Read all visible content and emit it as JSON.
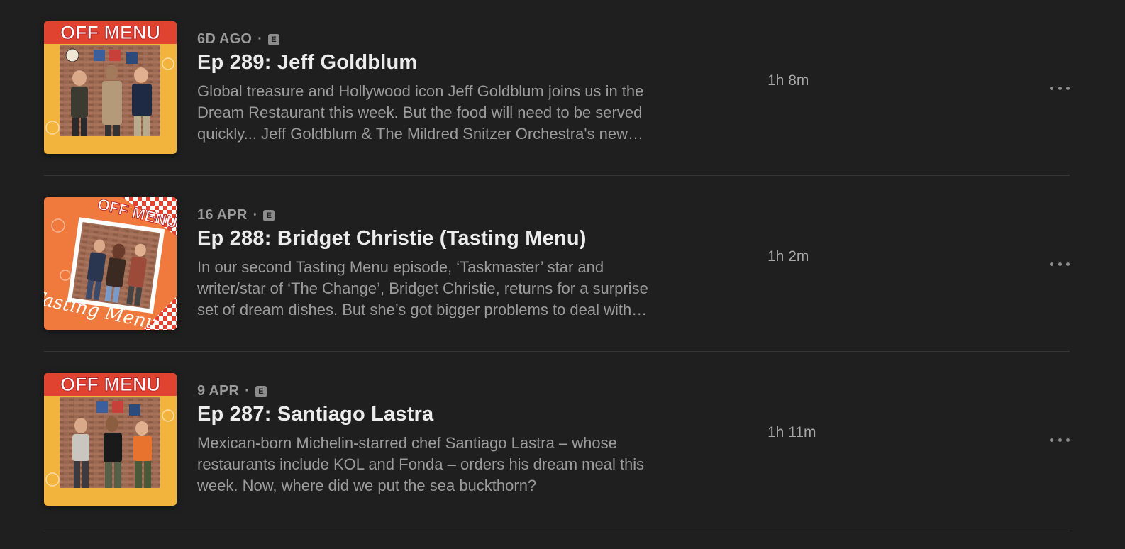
{
  "episodes": [
    {
      "date": "6D AGO",
      "explicit": "E",
      "title": "Ep 289: Jeff Goldblum",
      "description": "Global treasure and Hollywood icon Jeff Goldblum joins us in the Dream Restaurant this week. But the food will need to be served quickly...  Jeff Goldblum & The Mildred Snitzer Orchestra's new album is out now.",
      "duration": "1h 8m",
      "artwork": {
        "brand": "OFF MENU",
        "variant": "standard",
        "bg": "#f2b43c"
      }
    },
    {
      "date": "16 APR",
      "explicit": "E",
      "title": "Ep 288: Bridget Christie (Tasting Menu)",
      "description": "In our second Tasting Menu episode, ‘Taskmaster’ star and writer/star of ‘The Change’, Bridget Christie, returns for a surprise set of dream dishes. But she’s got bigger problems to deal with first.",
      "duration": "1h 2m",
      "artwork": {
        "brand": "OFF MENU",
        "subtitle": "Tasting Menu",
        "variant": "tasting",
        "bg": "#f07a3e"
      }
    },
    {
      "date": "9 APR",
      "explicit": "E",
      "title": "Ep 287: Santiago Lastra",
      "description": "Mexican-born Michelin-starred chef Santiago Lastra – whose restaurants include KOL and Fonda – orders his dream meal this week. Now, where did we put the sea buckthorn?",
      "duration": "1h 11m",
      "artwork": {
        "brand": "OFF MENU",
        "variant": "standard",
        "bg": "#f2b43c"
      }
    }
  ],
  "sep": "·"
}
